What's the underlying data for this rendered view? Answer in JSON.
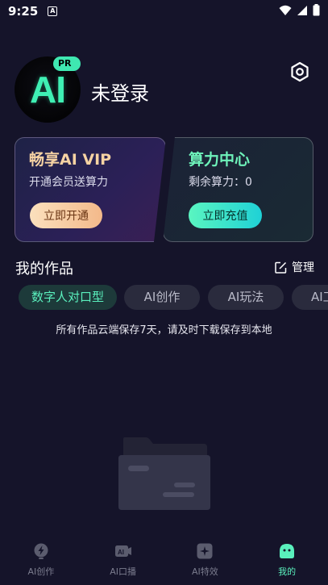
{
  "status_bar": {
    "time": "9:25",
    "a_icon": "A"
  },
  "profile": {
    "avatar_text": "AI",
    "avatar_badge": "PR",
    "username": "未登录"
  },
  "vip_card": {
    "title": "畅享AI VIP",
    "subtitle": "开通会员送算力",
    "button": "立即开通"
  },
  "power_card": {
    "title": "算力中心",
    "subtitle": "剩余算力：0",
    "button": "立即充值"
  },
  "works": {
    "title": "我的作品",
    "manage_label": "管理"
  },
  "tabs": [
    {
      "label": "数字人对口型",
      "active": true
    },
    {
      "label": "AI创作",
      "active": false
    },
    {
      "label": "AI玩法",
      "active": false
    },
    {
      "label": "AI工",
      "active": false
    }
  ],
  "notice": "所有作品云端保存7天，请及时下载保存到本地",
  "bottom_nav": [
    {
      "label": "AI创作",
      "icon": "bolt-icon",
      "active": false
    },
    {
      "label": "AI口播",
      "icon": "ai-video-icon",
      "active": false
    },
    {
      "label": "AI特效",
      "icon": "sparkle-icon",
      "active": false
    },
    {
      "label": "我的",
      "icon": "ghost-icon",
      "active": true
    }
  ],
  "colors": {
    "background": "#15142a",
    "accent": "#5af0bd",
    "vip_gold": "#f6d3a3"
  }
}
